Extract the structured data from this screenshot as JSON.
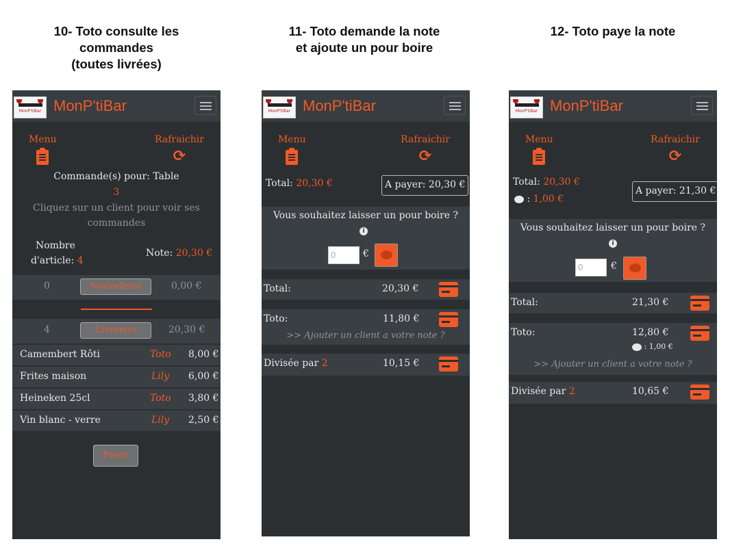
{
  "captions": {
    "c1": [
      "10- Toto consulte les",
      "commandes",
      "(toutes livrées)"
    ],
    "c2": [
      "11- Toto demande la note",
      "et ajoute un pour boire"
    ],
    "c3": [
      "12- Toto paye la note"
    ]
  },
  "app": {
    "brand": "MonP'tiBar",
    "logo_text": "MonP'tiBar",
    "menu_label": "Menu",
    "refresh_label": "Rafraichir",
    "accent_color": "#f05a28"
  },
  "screen1": {
    "orders_for": "Commande(s) pour: Table",
    "table_number": "3",
    "hint": "Cliquez sur un client pour voir ses commandes",
    "hint_l1": "Cliquez sur un client pour voir ses",
    "hint_l2": "commandes",
    "articles_label_l1": "Nombre",
    "articles_label_l2": "d'article:",
    "articles_count": "4",
    "note_label": "Note:",
    "note_amount": "20,30 €",
    "new_count": "0",
    "new_label": "Nouvelle(s)",
    "new_amount": "0,00 €",
    "delivered_count": "4",
    "delivered_label": "Livrée(s)",
    "delivered_amount": "20,30 €",
    "items": [
      {
        "name": "Camembert Rôti",
        "client": "Toto",
        "price": "8,00 €"
      },
      {
        "name": "Frites maison",
        "client": "Lily",
        "price": "6,00 €"
      },
      {
        "name": "Heineken 25cl",
        "client": "Toto",
        "price": "3,80 €"
      },
      {
        "name": "Vin blanc - verre",
        "client": "Lily",
        "price": "2,50 €"
      }
    ],
    "pay_button": "Payer"
  },
  "screen2": {
    "total_label": "Total:",
    "total_amount": "20,30 €",
    "to_pay": "A payer: 20,30 €",
    "tip_question": "Vous souhaitez laisser un pour boire ?",
    "tip_placeholder": "0",
    "currency": "€",
    "rows": {
      "total_label": "Total:",
      "total_amount": "20,30 €",
      "toto_label": "Toto:",
      "toto_amount": "11,80 €",
      "add_client": ">> Ajouter un client a votre note ?",
      "divided_label": "Divisée par",
      "divided_count": "2",
      "divided_amount": "10,15 €"
    }
  },
  "screen3": {
    "total_label": "Total:",
    "total_amount": "20,30 €",
    "tip_amount": "1,00 €",
    "to_pay": "A payer: 21,30 €",
    "tip_question": "Vous souhaitez laisser un pour boire ?",
    "tip_placeholder": "0",
    "currency": "€",
    "rows": {
      "total_label": "Total:",
      "total_amount": "21,30 €",
      "toto_label": "Toto:",
      "toto_amount": "12,80 €",
      "toto_tip": ": 1,00 €",
      "add_client": ">> Ajouter un client a votre note ?",
      "divided_label": "Divisée par",
      "divided_count": "2",
      "divided_amount": "10,65 €"
    }
  }
}
